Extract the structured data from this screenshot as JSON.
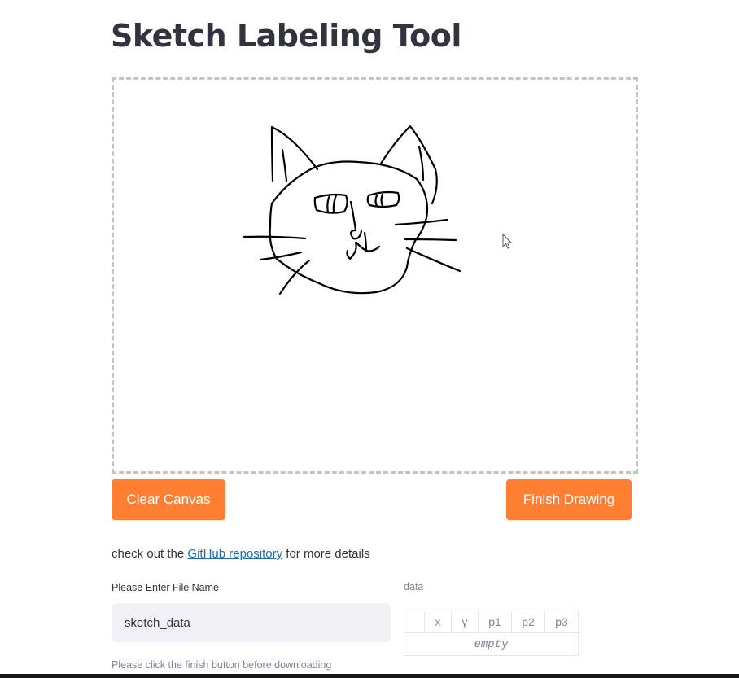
{
  "page": {
    "title": "Sketch Labeling Tool"
  },
  "canvas": {
    "subject": "cat-sketch",
    "stroke_color": "#000000"
  },
  "buttons": {
    "clear_label": "Clear Canvas",
    "finish_label": "Finish Drawing",
    "accent_color": "#ff7f32"
  },
  "info": {
    "prefix": "check out the ",
    "link_text": "GitHub repository",
    "suffix": " for more details"
  },
  "file_name": {
    "label": "Please Enter File Name",
    "value": "sketch_data"
  },
  "data_table": {
    "label": "data",
    "columns": [
      "",
      "x",
      "y",
      "p1",
      "p2",
      "p3"
    ],
    "empty_text": "empty"
  },
  "hint": {
    "text": "Please click the finish button before downloading"
  }
}
